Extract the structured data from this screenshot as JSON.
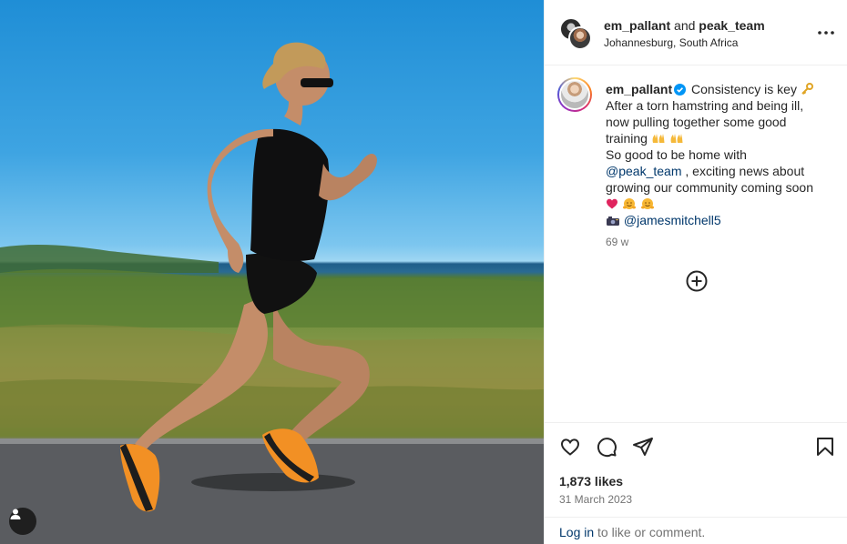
{
  "media": {
    "alt_icon": "user-tag-icon"
  },
  "header": {
    "user1": "em_pallant",
    "joiner": " and ",
    "user2": "peak_team",
    "location": "Johannesburg, South Africa",
    "more_icon": "ellipsis-icon"
  },
  "caption": {
    "username": "em_pallant",
    "text_line1": " Consistency is key ",
    "line2": "After a torn hamstring and being ill,",
    "line3": "now pulling together some good",
    "line4": "training ",
    "line5": "So good to be home with",
    "mention1": "@peak_team",
    "line6_rest": " , exciting news about",
    "line7": "growing our community coming soon",
    "mention2": "@jamesmitchell5",
    "age": "69 w"
  },
  "actions": {
    "likes": "1,873 likes",
    "date": "31 March 2023",
    "login_link": "Log in",
    "login_rest": " to like or comment."
  },
  "colors": {
    "text": "#262626",
    "muted": "#737373",
    "link": "#00376b",
    "verified": "#0095f6"
  }
}
